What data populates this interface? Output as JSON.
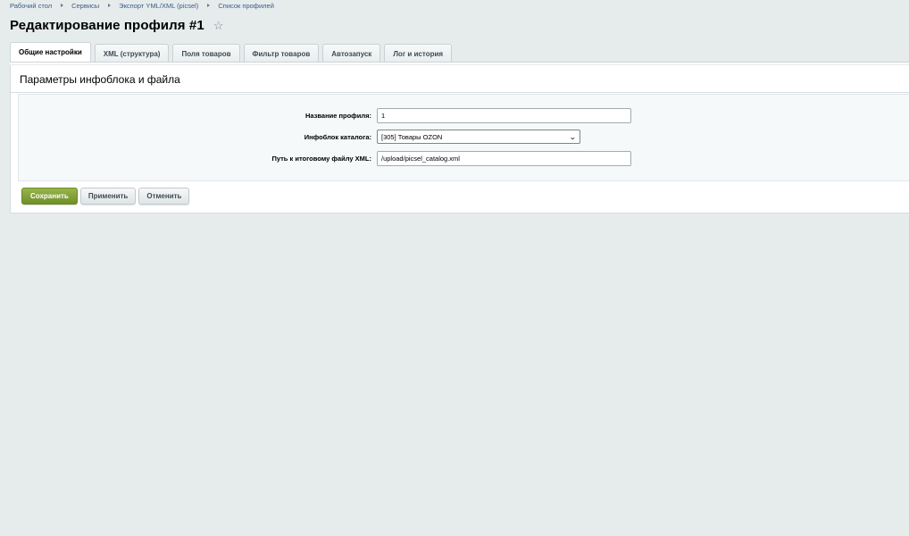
{
  "breadcrumb": [
    {
      "label": "Рабочий стол"
    },
    {
      "label": "Сервисы"
    },
    {
      "label": "Экспорт YML/XML (picsel)"
    },
    {
      "label": "Список профилей"
    }
  ],
  "page_title": "Редактирование профиля #1",
  "favorite_icon": "☆",
  "tabs": [
    {
      "label": "Общие настройки",
      "active": true
    },
    {
      "label": "XML (структура)",
      "active": false
    },
    {
      "label": "Поля товаров",
      "active": false
    },
    {
      "label": "Фильтр товаров",
      "active": false
    },
    {
      "label": "Автозапуск",
      "active": false
    },
    {
      "label": "Лог и история",
      "active": false
    }
  ],
  "section_title": "Параметры инфоблока и файла",
  "form": {
    "profile_name": {
      "label": "Название профиля:",
      "value": "1"
    },
    "catalog_iblock": {
      "label": "Инфоблок каталога:",
      "value": "[305] Товары OZON"
    },
    "xml_path": {
      "label": "Путь к итоговому файлу XML:",
      "value": "/upload/picsel_catalog.xml"
    }
  },
  "actions": {
    "save_label": "Сохранить",
    "apply_label": "Применить",
    "cancel_label": "Отменить"
  },
  "colors": {
    "page_bg": "#e6ebec",
    "primary_button": "#7e9c34",
    "breadcrumb_link": "#3a5b86"
  }
}
